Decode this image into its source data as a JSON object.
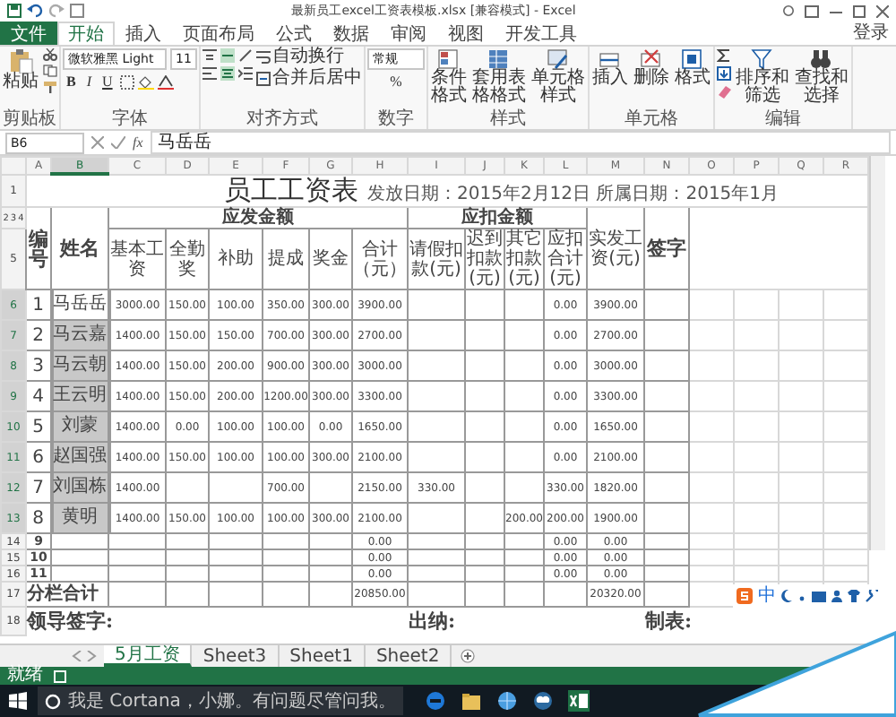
{
  "window": {
    "title": "最新员工excel工资表模板.xlsx [兼容模式] - Excel"
  },
  "ribbon": {
    "tabs": [
      {
        "label": "文件",
        "selected": false,
        "kind": "file"
      },
      {
        "label": "开始",
        "selected": true,
        "kind": "tab"
      },
      {
        "label": "插入",
        "selected": false,
        "kind": "tab"
      },
      {
        "label": "页面布局",
        "selected": false,
        "kind": "tab"
      },
      {
        "label": "公式",
        "selected": false,
        "kind": "tab"
      },
      {
        "label": "数据",
        "selected": false,
        "kind": "tab"
      },
      {
        "label": "审阅",
        "selected": false,
        "kind": "tab"
      },
      {
        "label": "视图",
        "selected": false,
        "kind": "tab"
      },
      {
        "label": "开发工具",
        "selected": false,
        "kind": "tab"
      }
    ],
    "sign_in": "登录",
    "groups": [
      {
        "label": "剪贴板",
        "commands": [
          "粘贴"
        ]
      },
      {
        "label": "字体",
        "font_name": "微软雅黑 Light",
        "font_size": "11",
        "styles": [
          "B",
          "I",
          "U"
        ]
      },
      {
        "label": "对齐方式",
        "commands": [
          "自动换行",
          "合并后居中"
        ]
      },
      {
        "label": "数字",
        "number_format": "常规",
        "symbol": "%"
      },
      {
        "label": "样式",
        "commands": [
          "条件格式",
          "套用表格格式",
          "单元格样式"
        ]
      },
      {
        "label": "单元格",
        "commands": [
          "插入",
          "删除",
          "格式"
        ]
      },
      {
        "label": "编辑",
        "commands": [
          "排序和筛选",
          "查找和选择"
        ]
      }
    ]
  },
  "formula_bar": {
    "name_box": "B6",
    "function_label": "fx",
    "value": "马岳岳"
  },
  "sheet": {
    "columns": [
      {
        "letter": "A",
        "selected": false
      },
      {
        "letter": "B",
        "selected": true
      },
      {
        "letter": "C",
        "selected": false
      },
      {
        "letter": "D",
        "selected": false
      },
      {
        "letter": "E",
        "selected": false
      },
      {
        "letter": "F",
        "selected": false
      },
      {
        "letter": "G",
        "selected": false
      },
      {
        "letter": "H",
        "selected": false
      },
      {
        "letter": "I",
        "selected": false
      },
      {
        "letter": "J",
        "selected": false
      },
      {
        "letter": "K",
        "selected": false
      },
      {
        "letter": "L",
        "selected": false
      },
      {
        "letter": "M",
        "selected": false
      },
      {
        "letter": "N",
        "selected": false
      },
      {
        "letter": "O",
        "selected": false
      },
      {
        "letter": "P",
        "selected": false
      },
      {
        "letter": "Q",
        "selected": false
      },
      {
        "letter": "R",
        "selected": false
      }
    ],
    "title_row": {
      "row_number": "1",
      "title": "员工工资表",
      "note": "发放日期：2015年2月12日 所属日期：2015年1月"
    },
    "header": {
      "row_numbers": [
        "2",
        "3",
        "4"
      ],
      "sub_row_number": "5",
      "number": "编号",
      "name": "姓名",
      "groups": [
        "应发金额",
        "应扣金额"
      ],
      "pay_columns": [
        "基本工资",
        "全勤奖",
        "补助",
        "提成",
        "奖金",
        "合计（元）"
      ],
      "deduction_columns": [
        "请假扣款(元)",
        "迟到扣款(元)",
        "其它扣款(元)",
        "应扣合计(元)"
      ],
      "net": "实发工资(元)",
      "signature": "签字"
    },
    "rows": [
      {
        "row_number": "6",
        "number": "1",
        "name": "马岳岳",
        "selected": true,
        "active": true,
        "cells": {
          "C": "3000.00",
          "D": "150.00",
          "E": "100.00",
          "F": "350.00",
          "G": "300.00",
          "H": "3900.00",
          "L": "0.00",
          "M": "3900.00"
        }
      },
      {
        "row_number": "7",
        "number": "2",
        "name": "马云嘉",
        "selected": true,
        "active": false,
        "cells": {
          "C": "1400.00",
          "D": "150.00",
          "E": "150.00",
          "F": "700.00",
          "G": "300.00",
          "H": "2700.00",
          "L": "0.00",
          "M": "2700.00"
        }
      },
      {
        "row_number": "8",
        "number": "3",
        "name": "马云朝",
        "selected": true,
        "active": false,
        "cells": {
          "C": "1400.00",
          "D": "150.00",
          "E": "200.00",
          "F": "900.00",
          "G": "300.00",
          "H": "3000.00",
          "L": "0.00",
          "M": "3000.00"
        }
      },
      {
        "row_number": "9",
        "number": "4",
        "name": "王云明",
        "selected": true,
        "active": false,
        "cells": {
          "C": "1400.00",
          "D": "150.00",
          "E": "200.00",
          "F": "1200.00",
          "G": "300.00",
          "H": "3300.00",
          "L": "0.00",
          "M": "3300.00"
        }
      },
      {
        "row_number": "10",
        "number": "5",
        "name": "刘蒙",
        "selected": true,
        "active": false,
        "cells": {
          "C": "1400.00",
          "D": "0.00",
          "E": "100.00",
          "F": "100.00",
          "G": "0.00",
          "H": "1650.00",
          "L": "0.00",
          "M": "1650.00"
        }
      },
      {
        "row_number": "11",
        "number": "6",
        "name": "赵国强",
        "selected": true,
        "active": false,
        "cells": {
          "C": "1400.00",
          "D": "150.00",
          "E": "100.00",
          "F": "100.00",
          "G": "300.00",
          "H": "2100.00",
          "L": "0.00",
          "M": "2100.00"
        }
      },
      {
        "row_number": "12",
        "number": "7",
        "name": "刘国栋",
        "selected": true,
        "active": false,
        "cells": {
          "C": "1400.00",
          "F": "700.00",
          "H": "2150.00",
          "I": "330.00",
          "L": "330.00",
          "M": "1820.00"
        }
      },
      {
        "row_number": "13",
        "number": "8",
        "name": "黄明",
        "selected": true,
        "active": false,
        "cells": {
          "C": "1400.00",
          "D": "150.00",
          "E": "100.00",
          "F": "100.00",
          "G": "300.00",
          "H": "2100.00",
          "K": "200.00",
          "L": "200.00",
          "M": "1900.00"
        }
      },
      {
        "row_number": "14",
        "number": "9",
        "selected": false,
        "cells": {
          "H": "0.00",
          "L": "0.00",
          "M": "0.00"
        }
      },
      {
        "row_number": "15",
        "number": "10",
        "selected": false,
        "cells": {
          "H": "0.00",
          "L": "0.00",
          "M": "0.00"
        }
      },
      {
        "row_number": "16",
        "number": "11",
        "selected": false,
        "cells": {
          "H": "0.00",
          "L": "0.00",
          "M": "0.00"
        }
      }
    ],
    "total_row": {
      "row_number": "17",
      "label": "分栏合计",
      "cells": {
        "H": "20850.00",
        "M": "20320.00"
      }
    },
    "signature_row": {
      "row_number": "18",
      "labels": [
        "领导签字:",
        "出纳:",
        "制表:"
      ]
    }
  },
  "sheet_tabs": [
    {
      "label": "5月工资",
      "selected": true
    },
    {
      "label": "Sheet3",
      "selected": false
    },
    {
      "label": "Sheet1",
      "selected": false
    },
    {
      "label": "Sheet2",
      "selected": false
    }
  ],
  "status_bar": {
    "text": "就绪"
  },
  "taskbar": {
    "search_placeholder": "我是 Cortana，小娜。有问题尽管问我。"
  },
  "ime_bar": {
    "label": "中"
  }
}
